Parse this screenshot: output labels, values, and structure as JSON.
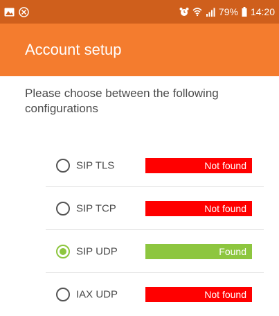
{
  "status_bar": {
    "icons_left": [
      "image-icon",
      "close-circle-icon"
    ],
    "icons_right": [
      "alarm-icon",
      "wifi-icon",
      "signal-icon"
    ],
    "battery": "79%",
    "time": "14:20"
  },
  "app_bar": {
    "title": "Account setup"
  },
  "instructions": "Please choose between the following configurations",
  "options": [
    {
      "label": "SIP TLS",
      "status": "Not found",
      "selected": false
    },
    {
      "label": "SIP TCP",
      "status": "Not found",
      "selected": false
    },
    {
      "label": "SIP UDP",
      "status": "Found",
      "selected": true
    },
    {
      "label": "IAX UDP",
      "status": "Not found",
      "selected": false
    }
  ],
  "colors": {
    "status_bar_bg": "#cf5f1c",
    "app_bar_bg": "#f47c2e",
    "not_found": "#ff0000",
    "found": "#8dc63f",
    "radio_checked": "#8dc63f"
  }
}
